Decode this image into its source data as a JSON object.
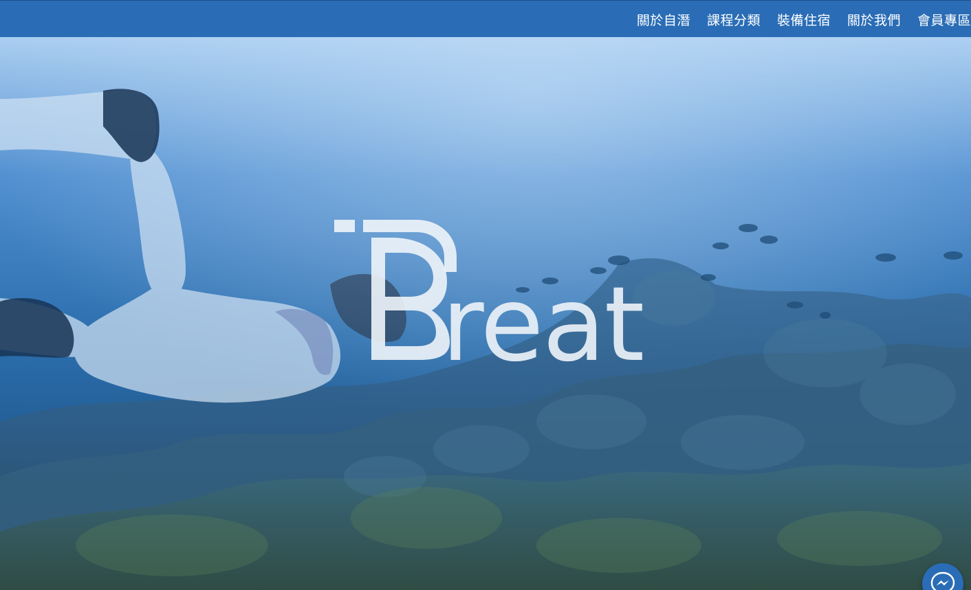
{
  "nav": {
    "items": [
      {
        "label": "關於自潛"
      },
      {
        "label": "課程分類"
      },
      {
        "label": "裝備住宿"
      },
      {
        "label": "關於我們"
      },
      {
        "label": "會員專區"
      }
    ]
  },
  "hero": {
    "logo_text": "Breath"
  },
  "colors": {
    "nav_bg": "#2a6db6",
    "water_top": "#a9cdf0",
    "water_deep": "#1d5f9f",
    "logo": "#eef4fa"
  },
  "icons": {
    "messenger": "messenger-icon"
  }
}
